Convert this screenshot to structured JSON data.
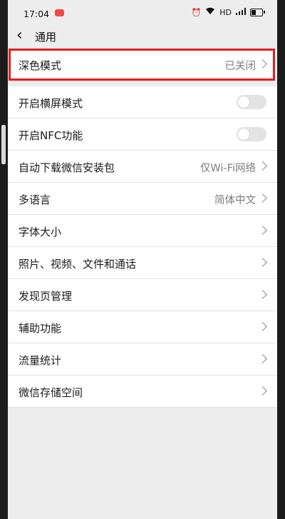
{
  "status": {
    "time": "17:04",
    "icons_text": "HD"
  },
  "nav": {
    "back_icon": "chevron-left-icon",
    "title": "通用"
  },
  "items": [
    {
      "label": "深色模式",
      "value": "已关闭",
      "type": "link"
    },
    {
      "label": "开启横屏模式",
      "type": "toggle",
      "on": false
    },
    {
      "label": "开启NFC功能",
      "type": "toggle",
      "on": false
    },
    {
      "label": "自动下载微信安装包",
      "value": "仅Wi-Fi网络",
      "type": "link"
    },
    {
      "label": "多语言",
      "value": "简体中文",
      "type": "link"
    },
    {
      "label": "字体大小",
      "type": "link"
    },
    {
      "label": "照片、视频、文件和通话",
      "type": "link"
    },
    {
      "label": "发现页管理",
      "type": "link"
    },
    {
      "label": "辅助功能",
      "type": "link"
    },
    {
      "label": "流量统计",
      "type": "link"
    },
    {
      "label": "微信存储空间",
      "type": "link"
    }
  ],
  "colors": {
    "highlight": "#e81c1c",
    "background": "#ededed"
  }
}
